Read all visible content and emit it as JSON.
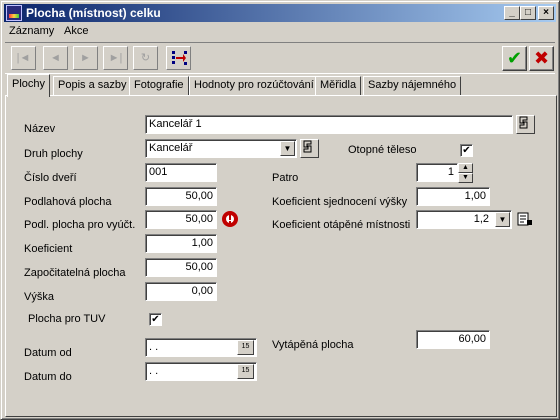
{
  "window": {
    "title": "Plocha (místnost) celku",
    "min": "_",
    "max": "□",
    "close": "×"
  },
  "menu": [
    "Záznamy",
    "Akce"
  ],
  "toolbar": {
    "first": "|◄",
    "prev": "◄",
    "next": "►",
    "last": "►|",
    "refresh": "↻",
    "ok": "✔",
    "cancel": "✖",
    "ok_color": "#00a000",
    "cancel_color": "#c00000"
  },
  "tabs": [
    "Plochy",
    "Popis a sazby",
    "Fotografie",
    "Hodnoty pro rozúčtování",
    "Měřidla",
    "Sazby nájemného"
  ],
  "form": {
    "nazev": {
      "label": "Název",
      "value": "Kancelář 1"
    },
    "druh": {
      "label": "Druh plochy",
      "value": "Kancelář"
    },
    "otopne": {
      "label": "Otopné těleso",
      "checked": "✔"
    },
    "cislo": {
      "label": "Číslo dveří",
      "value": "001"
    },
    "patro": {
      "label": "Patro",
      "value": "1"
    },
    "podlahova": {
      "label": "Podlahová plocha",
      "value": "50,00"
    },
    "koef_sjed": {
      "label": "Koeficient sjednocení výšky",
      "value": "1,00"
    },
    "podl_vyuct": {
      "label": "Podl. plocha pro vyúčt.",
      "value": "50,00"
    },
    "koef_otap": {
      "label": "Koeficient otápěné místnosti",
      "value": "1,2"
    },
    "koeficient": {
      "label": "Koeficient",
      "value": "1,00"
    },
    "zapocitatelna": {
      "label": "Započitatelná plocha",
      "value": "50,00"
    },
    "vyska": {
      "label": "Výška",
      "value": "0,00"
    },
    "tuv": {
      "label": "Plocha pro TUV",
      "checked": "✔"
    },
    "datum_od": {
      "label": "Datum od",
      "value": " .  ."
    },
    "datum_do": {
      "label": "Datum do",
      "value": " .  ."
    },
    "vytapena": {
      "label": "Vytápěná plocha",
      "value": "60,00"
    }
  }
}
